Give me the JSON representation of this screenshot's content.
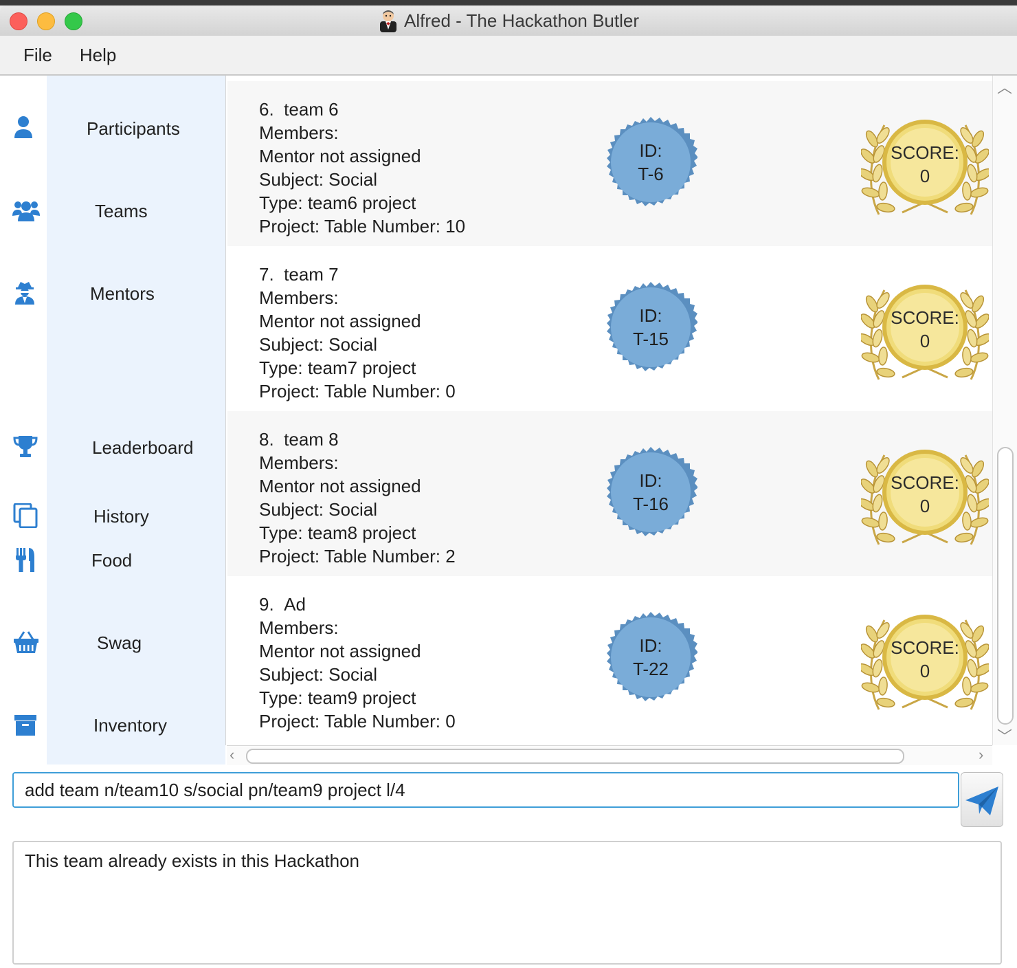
{
  "window": {
    "title": "Alfred - The Hackathon Butler"
  },
  "menu": {
    "file": "File",
    "help": "Help"
  },
  "sidebar": {
    "items": [
      {
        "label": "Participants",
        "icon": "user-icon"
      },
      {
        "label": "Teams",
        "icon": "users-icon"
      },
      {
        "label": "Mentors",
        "icon": "user-secret-icon"
      },
      {
        "label": "Leaderboard",
        "icon": "trophy-icon"
      },
      {
        "label": "History",
        "icon": "copy-icon"
      },
      {
        "label": "Food",
        "icon": "utensils-icon"
      },
      {
        "label": "Swag",
        "icon": "basket-icon"
      },
      {
        "label": "Inventory",
        "icon": "archive-icon"
      }
    ]
  },
  "teams": [
    {
      "index": "6.",
      "name": "team 6",
      "members": "Members:",
      "mentor": "Mentor not assigned",
      "subject": "Subject: Social",
      "type": "Type: team6 project",
      "project": "Project:  Table Number: 10",
      "id_label": "ID:",
      "id": "T-6",
      "score_label": "SCORE:",
      "score": "0"
    },
    {
      "index": "7.",
      "name": "team 7",
      "members": "Members:",
      "mentor": "Mentor not assigned",
      "subject": "Subject: Social",
      "type": "Type: team7 project",
      "project": "Project:  Table Number: 0",
      "id_label": "ID:",
      "id": "T-15",
      "score_label": "SCORE:",
      "score": "0"
    },
    {
      "index": "8.",
      "name": "team 8",
      "members": "Members:",
      "mentor": "Mentor not assigned",
      "subject": "Subject: Social",
      "type": "Type: team8 project",
      "project": "Project:  Table Number: 2",
      "id_label": "ID:",
      "id": "T-16",
      "score_label": "SCORE:",
      "score": "0"
    },
    {
      "index": "9.",
      "name": "Ad",
      "members": "Members:",
      "mentor": "Mentor not assigned",
      "subject": "Subject: Social",
      "type": "Type: team9 project",
      "project": "Project:  Table Number: 0",
      "id_label": "ID:",
      "id": "T-22",
      "score_label": "SCORE:",
      "score": "0"
    }
  ],
  "command": {
    "value": "add team n/team10 s/social pn/team9 project l/4"
  },
  "result": {
    "text": "This team already exists in this Hackathon"
  },
  "colors": {
    "accent": "#2d7fd0",
    "badge_blue": "#7aacd8",
    "gold": "#e9cf5c",
    "sidebar_bg": "#ebf3fd"
  }
}
